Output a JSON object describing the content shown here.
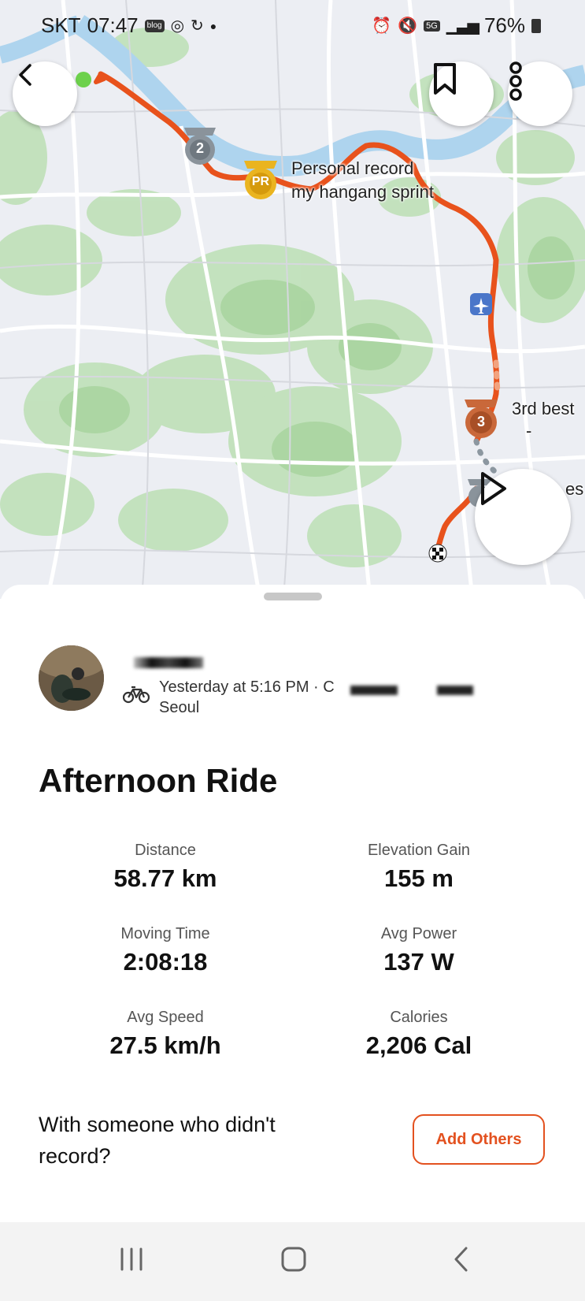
{
  "status_bar": {
    "carrier": "SKT",
    "time": "07:47",
    "network": "5G",
    "battery": "76%"
  },
  "map": {
    "labels": {
      "pr_line1": "Personal record",
      "pr_line2": "my hangang sprint",
      "third_best": "3rd best",
      "dash": "-",
      "partial": "es"
    },
    "badges": {
      "two": "2",
      "pr": "PR",
      "three": "3"
    },
    "route_color": "#e8521c"
  },
  "activity": {
    "meta_line1": "Yesterday at 5:16 PM · C",
    "meta_line2": "Seoul",
    "title": "Afternoon Ride",
    "stats": [
      {
        "label": "Distance",
        "value": "58.77 km"
      },
      {
        "label": "Elevation Gain",
        "value": "155 m"
      },
      {
        "label": "Moving Time",
        "value": "2:08:18"
      },
      {
        "label": "Avg Power",
        "value": "137 W"
      },
      {
        "label": "Avg Speed",
        "value": "27.5 km/h"
      },
      {
        "label": "Calories",
        "value": "2,206 Cal"
      }
    ],
    "with_prompt": "With someone who didn't record?",
    "add_others": "Add Others"
  },
  "icons": {
    "back": "back-chevron-icon",
    "bookmark": "bookmark-icon",
    "more": "more-vertical-icon",
    "play": "play-icon",
    "bike": "bike-icon",
    "airport": "airport-icon"
  }
}
